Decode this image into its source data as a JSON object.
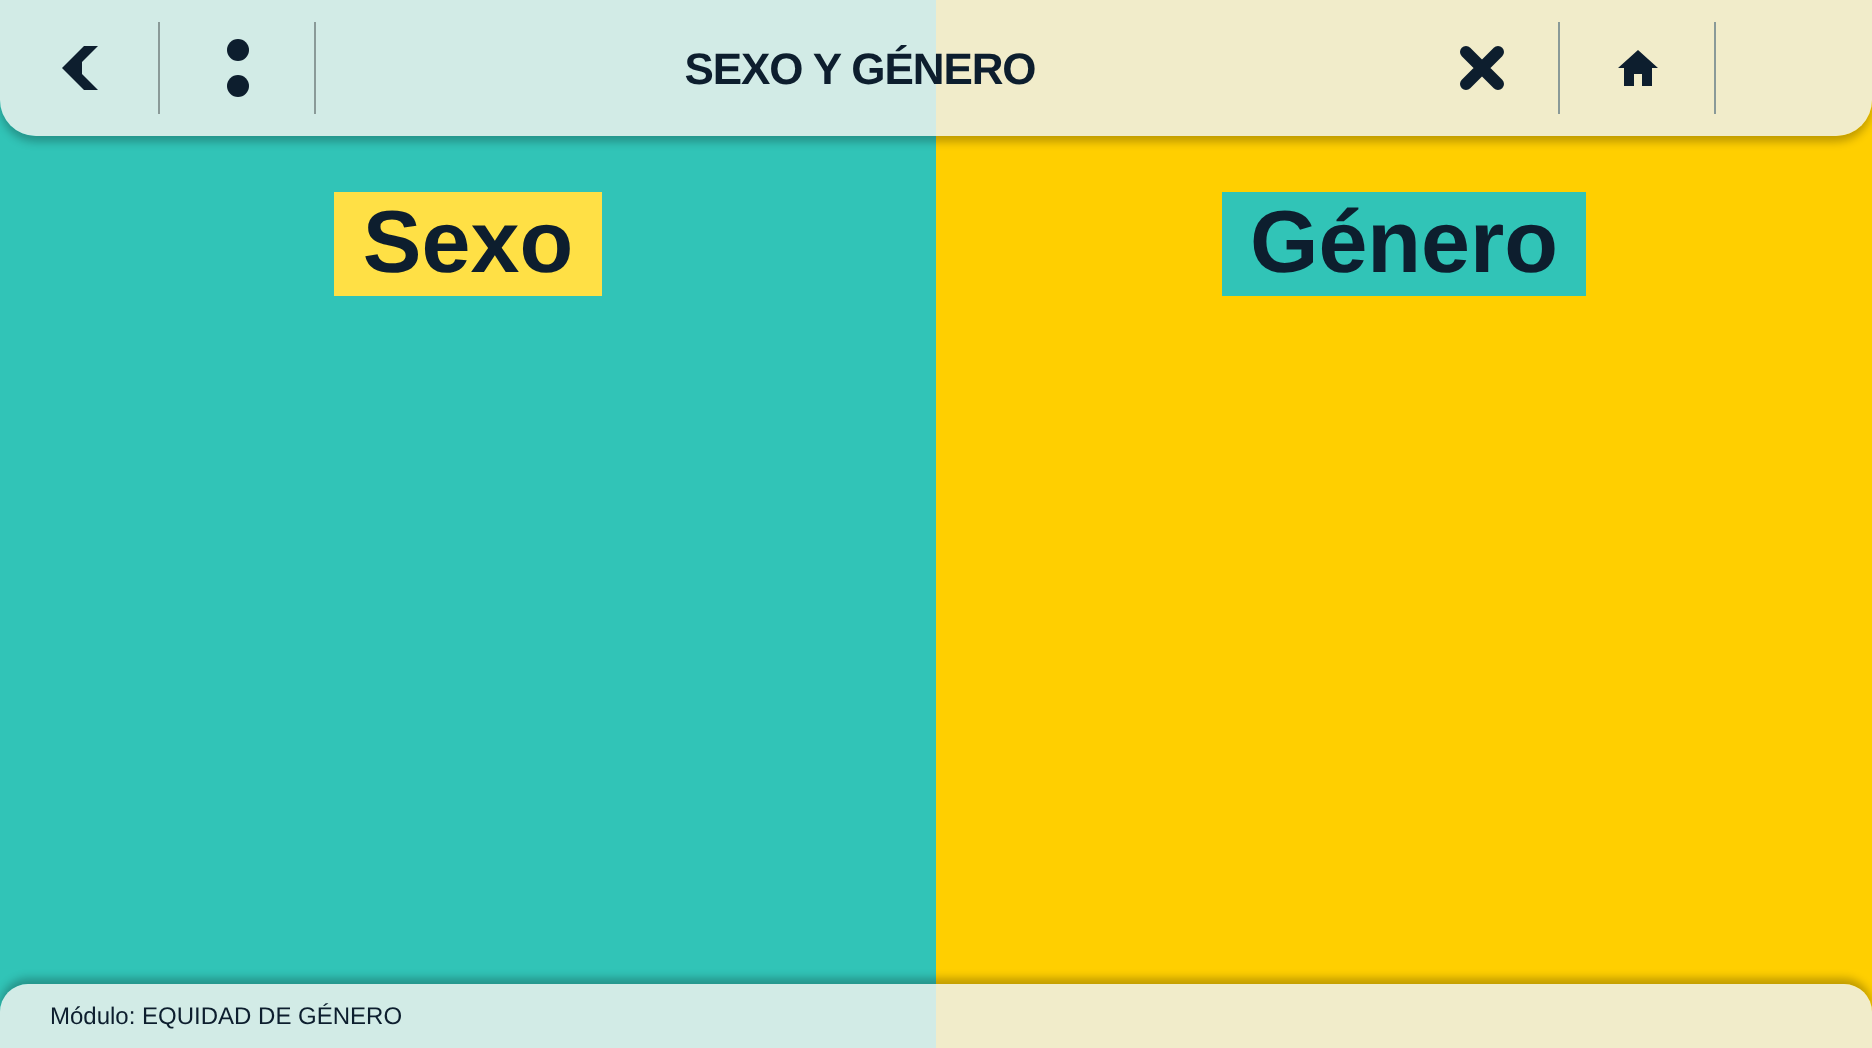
{
  "header": {
    "title": "SEXO Y GÉNERO"
  },
  "panels": [
    {
      "heading": "Sexo"
    },
    {
      "heading": "Género"
    }
  ],
  "footer": {
    "text": "Módulo: EQUIDAD DE GÉNERO"
  }
}
